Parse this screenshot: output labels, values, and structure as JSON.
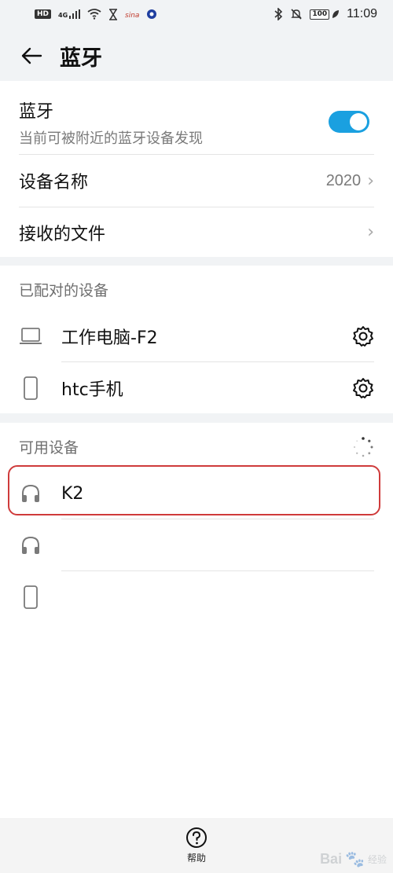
{
  "status_bar": {
    "left_hd": "HD",
    "left_net": "4G",
    "time": "11:09",
    "battery": "100",
    "icons": [
      "hd-icon",
      "signal-icon",
      "wifi-icon",
      "hourglass-icon",
      "app-notification-icon",
      "circle-app-icon",
      "bluetooth-icon",
      "mute-icon",
      "battery-icon",
      "leaf-icon"
    ]
  },
  "header": {
    "title": "蓝牙",
    "back_icon": "arrow-left-icon"
  },
  "bluetooth": {
    "title": "蓝牙",
    "subtitle": "当前可被附近的蓝牙设备发现",
    "enabled": true,
    "toggle_color": "#1aa0e0"
  },
  "device_name": {
    "label": "设备名称",
    "value": "2020"
  },
  "received_files": {
    "label": "接收的文件"
  },
  "paired": {
    "header": "已配对的设备",
    "devices": [
      {
        "name": "工作电脑-F2",
        "icon": "laptop-icon"
      },
      {
        "name": "htc手机",
        "icon": "phone-icon"
      }
    ]
  },
  "available": {
    "header": "可用设备",
    "devices": [
      {
        "name": "K2",
        "icon": "headphones-icon"
      },
      {
        "name": "",
        "icon": "headphones-icon"
      },
      {
        "name": "",
        "icon": "phone-icon"
      }
    ],
    "highlight_color": "#cf3b3b"
  },
  "bottom": {
    "help_label": "帮助"
  },
  "watermark": {
    "text": "Bai",
    "sub": "经验"
  }
}
